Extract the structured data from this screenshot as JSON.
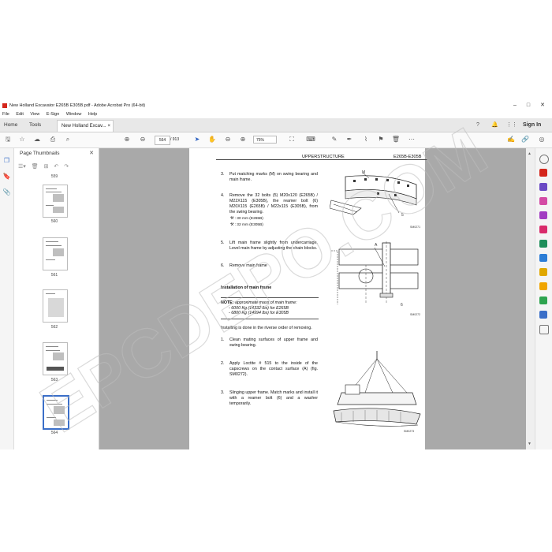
{
  "window": {
    "title": "New Holland Excavator E265B E305B.pdf - Adobe Acrobat Pro (64-bit)",
    "controls": [
      "–",
      "□",
      "✕"
    ]
  },
  "menu": [
    "File",
    "Edit",
    "View",
    "E-Sign",
    "Window",
    "Help"
  ],
  "tabs": {
    "home": "Home",
    "tools": "Tools",
    "document": "New Holland Excav...",
    "document_close": "×",
    "sign_in": "Sign In"
  },
  "toolbar": {
    "page_current": "564",
    "page_total": "/ 913",
    "zoom": "75%"
  },
  "thumbnails": {
    "panel_title": "Page Thumbnails",
    "close": "✕",
    "pages": [
      "559",
      "560",
      "561",
      "562",
      "563",
      "564"
    ]
  },
  "document": {
    "header_center": "UPPERSTRUCTURE",
    "header_right": "E265B-E305B",
    "steps": [
      {
        "n": "3.",
        "text": "Put matching marks (M) on swing bearing and main frame."
      },
      {
        "n": "4.",
        "text": "Remove the 32 bolts (5) M20x120 (E265B) / M22X115 (E305B), the reamer bolt (6) M20X115 (E265B) / M22x115 (E305B), from the swing bearing."
      },
      {
        "n": "5.",
        "text": "Lift main frame slightly from undercarriage. Level main frame by adjusting the chain blocks."
      },
      {
        "n": "6.",
        "text": "Remove main frame"
      }
    ],
    "wrench_1": ": 30 mm (E265B)",
    "wrench_2": ": 32 mm (E305B)",
    "section_title": "Installation of main frame",
    "note_label": "NOTE:",
    "note_text": "approximate mass of main frame:",
    "note_line1": "- 6000 Kg (14332 lbs) for E265B",
    "note_line2": "- 6800 Kg (14994 lbs) for E305B",
    "install_intro": "Installing is done in the riverse order of removing.",
    "install_steps": [
      {
        "n": "1.",
        "text": "Clean mating surfaces of upper frame and swing bearing."
      },
      {
        "n": "2.",
        "text": "Apply Loctite # 515 to the inside of the capscrews on the contact surface (A) (fig. SM0272)."
      },
      {
        "n": "3.",
        "text": "Slinging upper frame. Match marks and install it with a reamer bolt (6) and a washer temporarily."
      }
    ],
    "fig_labels": {
      "fig1_m": "M",
      "fig1_s": "5",
      "fig1_id": "SM0271",
      "fig2_a": "A",
      "fig2_6": "6",
      "fig2_id": "SM0272",
      "fig3_id": "SM0273"
    }
  },
  "watermark": "EPCDEPO.COM",
  "colors": {
    "accent": "#3b6fc8",
    "brand_red": "#d4261c",
    "viewer_bg": "#a9a9a9"
  }
}
